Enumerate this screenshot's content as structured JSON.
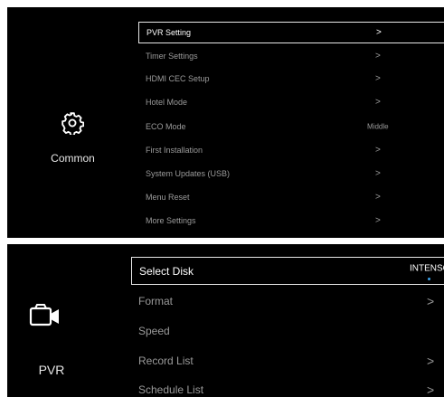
{
  "common_panel": {
    "category_label": "Common",
    "category_icon": "gear-icon",
    "items": [
      {
        "label": "PVR Setting",
        "value": ">",
        "selected": true
      },
      {
        "label": "Timer Settings",
        "value": ">"
      },
      {
        "label": "HDMI CEC Setup",
        "value": ">"
      },
      {
        "label": "Hotel Mode",
        "value": ">"
      },
      {
        "label": "ECO Mode",
        "value": "Middle"
      },
      {
        "label": "First Installation",
        "value": ">"
      },
      {
        "label": "System Updates (USB)",
        "value": ">"
      },
      {
        "label": "Menu Reset",
        "value": ">"
      },
      {
        "label": "More Settings",
        "value": ">"
      }
    ]
  },
  "pvr_panel": {
    "category_label": "PVR",
    "category_icon": "video-camera-icon",
    "items": [
      {
        "label": "Select Disk",
        "value": "INTENSO",
        "selected": true
      },
      {
        "label": "Format",
        "value": ">"
      },
      {
        "label": "Speed",
        "value": ""
      },
      {
        "label": "Record List",
        "value": ">"
      },
      {
        "label": "Schedule List",
        "value": ">"
      }
    ]
  },
  "colors": {
    "background": "#000000",
    "selected_border": "#e8e8e8",
    "text": "#9a9a9a",
    "selected_text": "#ffffff",
    "indicator_dot": "#3aa0e8"
  }
}
